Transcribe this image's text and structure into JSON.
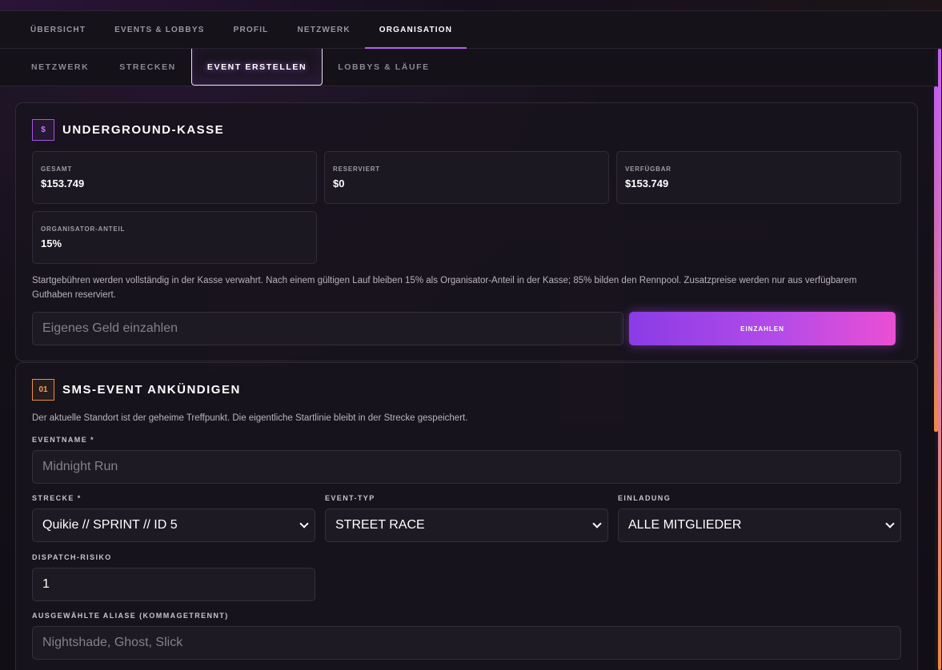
{
  "nav_primary": {
    "tabs": [
      {
        "label": "ÜBERSICHT",
        "active": false
      },
      {
        "label": "EVENTS & LOBBYS",
        "active": false
      },
      {
        "label": "PROFIL",
        "active": false
      },
      {
        "label": "NETZWERK",
        "active": false
      },
      {
        "label": "ORGANISATION",
        "active": true
      }
    ]
  },
  "nav_secondary": {
    "tabs": [
      {
        "label": "NETZWERK",
        "active": false
      },
      {
        "label": "STRECKEN",
        "active": false
      },
      {
        "label": "EVENT ERSTELLEN",
        "active": true
      },
      {
        "label": "LOBBYS & LÄUFE",
        "active": false
      }
    ]
  },
  "treasury": {
    "badge": "$",
    "title": "UNDERGROUND-KASSE",
    "stats": [
      {
        "label": "GESAMT",
        "value": "$153.749"
      },
      {
        "label": "RESERVIERT",
        "value": "$0"
      },
      {
        "label": "VERFÜGBAR",
        "value": "$153.749"
      },
      {
        "label": "ORGANISATOR-ANTEIL",
        "value": "15%"
      }
    ],
    "note_line1": "Startgebühren werden vollständig in der Kasse verwahrt. Nach einem gültigen Lauf bleiben 15% als Organisator-Anteil in der Kasse; 85% bilden den Rennpool. Zusatzpreise werden nur aus verfügbarem",
    "note_line2": "Guthaben reserviert.",
    "deposit_placeholder": "Eigenes Geld einzahlen",
    "deposit_button": "EINZAHLEN"
  },
  "sms_event": {
    "badge": "01",
    "title": "SMS-EVENT ANKÜNDIGEN",
    "description": "Der aktuelle Standort ist der geheime Treffpunkt. Die eigentliche Startlinie bleibt in der Strecke gespeichert.",
    "event_name_label": "EVENTNAME *",
    "event_name_placeholder": "Midnight Run",
    "track_label": "STRECKE *",
    "track_value": "Quikie // SPRINT // ID 5",
    "event_type_label": "EVENT-TYP",
    "event_type_value": "STREET RACE",
    "invite_label": "EINLADUNG",
    "invite_value": "ALLE MITGLIEDER",
    "dispatch_label": "DISPATCH-RISIKO",
    "dispatch_value": "1",
    "aliases_label": "AUSGEWÄHLTE ALIASE (KOMMAGETRENNT)",
    "aliases_placeholder": "Nightshade, Ghost, Slick"
  },
  "colors": {
    "accent_purple": "#b55ff0",
    "accent_orange": "#e8903a",
    "button_gradient_start": "#8a3ce6",
    "button_gradient_end": "#ea4fd3"
  }
}
